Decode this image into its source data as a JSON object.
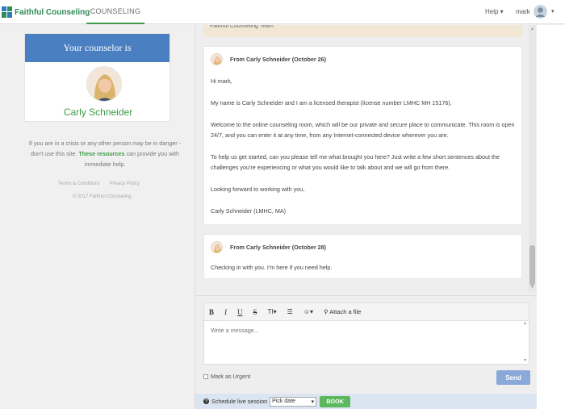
{
  "nav": {
    "logo_text": "Faithful Counseling",
    "tab_label": "COUNSELING",
    "help_label": "Help ▾",
    "user_name": "mark",
    "user_caret": "▾"
  },
  "sidebar": {
    "header": "Your counselor is",
    "counselor_name": "Carly Schneider",
    "crisis_before": "If you are in a crisis or any other person may be in danger - don't use this site.",
    "crisis_link": "These resources",
    "crisis_after": "can provide you with immediate help.",
    "terms": "Terms & Conditions",
    "privacy": "Privacy Policy",
    "copyright": "© 2017 Faithful Counseling"
  },
  "thread": {
    "team_strip": "Faithful Counseling Team",
    "messages": [
      {
        "from": "From Carly Schneider (October 26)",
        "paragraphs": [
          "Hi mark,",
          "My name is Carly Schneider and I am a licensed therapist (license number LMHC MH 15176).",
          "Welcome to the online counseling room, which will be our private and secure place to communicate. This room is open 24/7, and you can enter it at any time, from any Internet-connected device wherever you are.",
          "To help us get started, can you please tell me what brought you here? Just write a few short sentences about the challenges you're experiencing or what you would like to talk about and we will go from there.",
          "Looking forward to working with you,",
          "Carly Schneider (LMHC, MA)"
        ]
      },
      {
        "from": "From Carly Schneider (October 28)",
        "paragraphs": [
          "Checking in with you. I'm here if you need help."
        ]
      }
    ]
  },
  "composer": {
    "bold": "B",
    "italic": "I",
    "underline": "U",
    "strike": "S",
    "text_size": "TI▾",
    "list": "☰",
    "emoji": "☺▾",
    "attach": "Attach a file",
    "placeholder": "Write a message...",
    "urgent_label": "Mark as Urgent",
    "send_label": "Send"
  },
  "schedule": {
    "label": "Schedule live session",
    "pick_date": "Pick date",
    "book_label": "BOOK"
  },
  "colors": {
    "brand_green": "#3d9c47",
    "header_blue": "#4a7fc1",
    "send_blue": "#8ba9d8",
    "book_green": "#5cb85c"
  }
}
